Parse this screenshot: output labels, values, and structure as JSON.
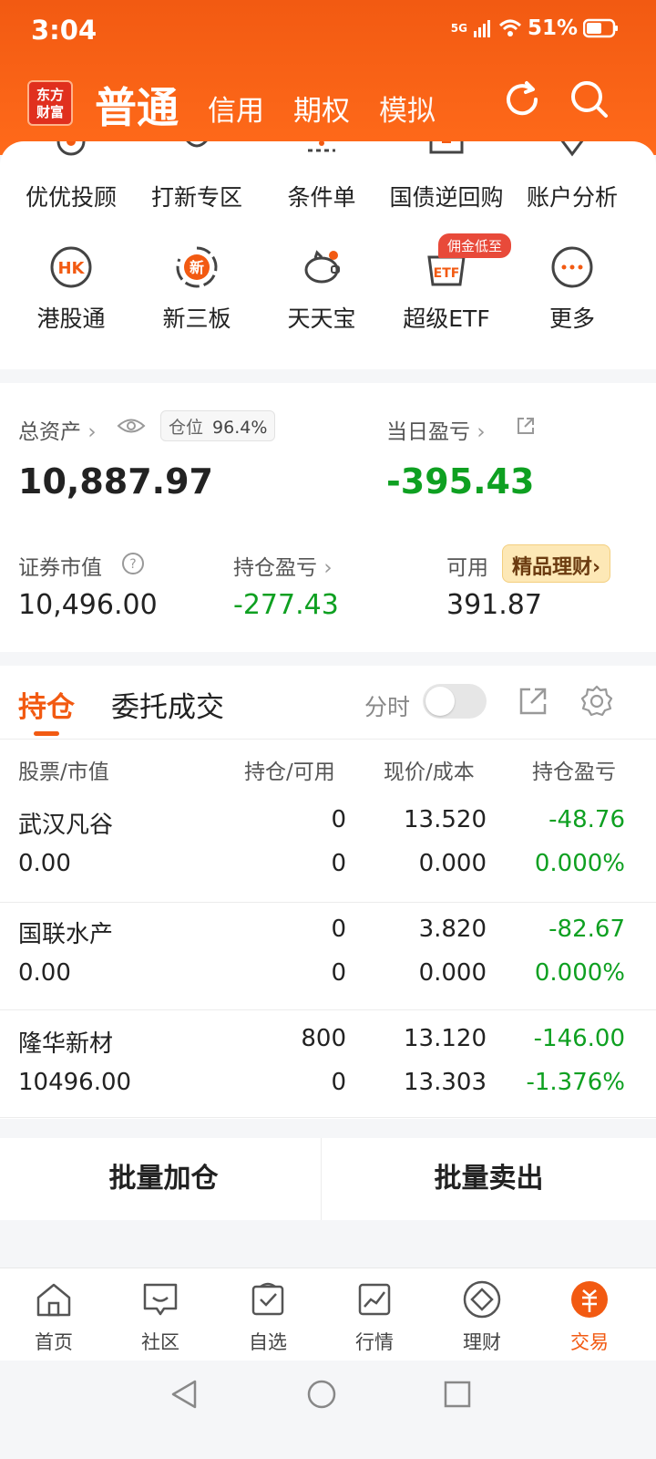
{
  "status": {
    "time": "3:04",
    "network": "5G",
    "battery": "51%"
  },
  "header": {
    "logo_line1": "东方",
    "logo_line2": "财富",
    "tabs": [
      {
        "label": "普通",
        "active": true
      },
      {
        "label": "信用"
      },
      {
        "label": "期权"
      },
      {
        "label": "模拟"
      }
    ]
  },
  "grid": {
    "row1": [
      "优优投顾",
      "打新专区",
      "条件单",
      "国债逆回购",
      "账户分析"
    ],
    "row2": [
      "港股通",
      "新三板",
      "天天宝",
      "超级ETF",
      "更多"
    ],
    "hk_icon_text": "HK",
    "new_icon_text": "新",
    "etf_icon_text": "ETF",
    "etf_badge": "佣金低至"
  },
  "assets": {
    "total_label": "总资产",
    "position_label": "仓位",
    "position_value": "96.4%",
    "total_value": "10,887.97",
    "daily_pl_label": "当日盈亏",
    "daily_pl_value": "-395.43",
    "market_value_label": "证券市值",
    "market_value": "10,496.00",
    "holding_pl_label": "持仓盈亏",
    "holding_pl_value": "-277.43",
    "available_label": "可用",
    "available_value": "391.87",
    "licai_button": "精品理财"
  },
  "positions": {
    "tab_holdings": "持仓",
    "tab_orders": "委托成交",
    "timeshare_label": "分时",
    "columns": [
      "股票/市值",
      "持仓/可用",
      "现价/成本",
      "持仓盈亏"
    ],
    "rows": [
      {
        "name": "武汉凡谷",
        "market_value": "0.00",
        "hold": "0",
        "avail": "0",
        "price": "13.520",
        "cost": "0.000",
        "pl": "-48.76",
        "pl_pct": "0.000%"
      },
      {
        "name": "国联水产",
        "market_value": "0.00",
        "hold": "0",
        "avail": "0",
        "price": "3.820",
        "cost": "0.000",
        "pl": "-82.67",
        "pl_pct": "0.000%"
      },
      {
        "name": "隆华新材",
        "market_value": "10496.00",
        "hold": "800",
        "avail": "0",
        "price": "13.120",
        "cost": "13.303",
        "pl": "-146.00",
        "pl_pct": "-1.376%"
      }
    ]
  },
  "actions": {
    "batch_add": "批量加仓",
    "batch_sell": "批量卖出"
  },
  "bottom_nav": [
    {
      "label": "首页"
    },
    {
      "label": "社区"
    },
    {
      "label": "自选"
    },
    {
      "label": "行情"
    },
    {
      "label": "理财"
    },
    {
      "label": "交易",
      "active": true
    }
  ],
  "colors": {
    "brand": "#f25a12",
    "loss_green": "#0ea021",
    "licai_bg": "#fde8b6"
  }
}
